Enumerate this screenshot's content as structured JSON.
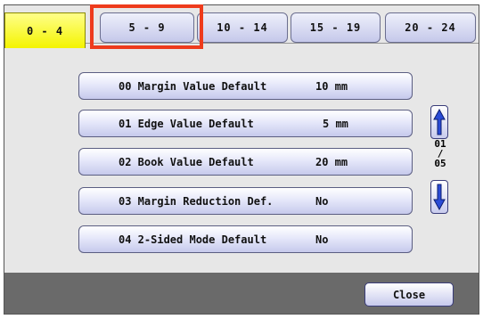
{
  "tabs": [
    {
      "label": "0 - 4",
      "active": true
    },
    {
      "label": "5 - 9",
      "active": false
    },
    {
      "label": "10 - 14",
      "active": false
    },
    {
      "label": "15 - 19",
      "active": false
    },
    {
      "label": "20 - 24",
      "active": false
    }
  ],
  "settings": [
    {
      "label": "00  Margin Value Default",
      "value": "10 mm"
    },
    {
      "label": "01  Edge Value Default",
      "value": "5 mm"
    },
    {
      "label": "02  Book Value Default",
      "value": "20 mm"
    },
    {
      "label": "03  Margin Reduction Def.",
      "value": "No"
    },
    {
      "label": "04  2-Sided Mode Default",
      "value": "No"
    }
  ],
  "pager": {
    "current": "01",
    "sep": "/",
    "total": "05"
  },
  "footer": {
    "close_label": "Close"
  },
  "colors": {
    "active_tab": "#f4f400",
    "highlight": "#ee3b1c",
    "button": "#c6c9ec",
    "footer": "#6a6a6a"
  }
}
